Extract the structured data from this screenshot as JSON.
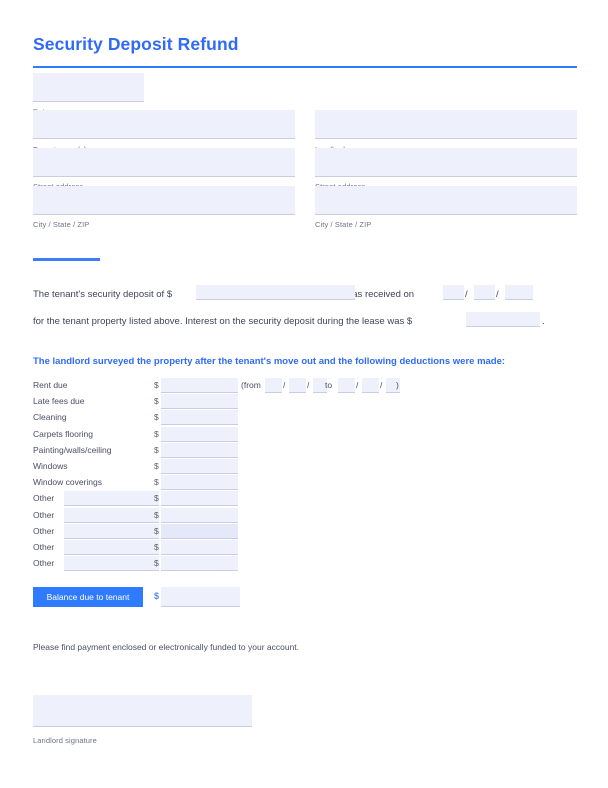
{
  "document": {
    "title": "Security Deposit Refund",
    "accent_color": "#2f7bff",
    "title_color": "#2f6bf6",
    "field_fill": "#eef0fb",
    "text_color": "#4a4f63"
  },
  "header": {
    "date_field": {
      "value": "",
      "placeholder": ""
    },
    "date_label": "Date",
    "left_column": [
      {
        "label": "Tenant name(s)",
        "value": "",
        "placeholder": ""
      },
      {
        "label": "Street address",
        "value": "",
        "placeholder": ""
      },
      {
        "label": "City / State / ZIP",
        "value": "",
        "placeholder": ""
      }
    ],
    "right_column": [
      {
        "label": "Landlord name",
        "value": "",
        "placeholder": ""
      },
      {
        "label": "Street address",
        "value": "",
        "placeholder": ""
      },
      {
        "label": "City / State / ZIP",
        "value": "",
        "placeholder": ""
      }
    ]
  },
  "body": {
    "line1_part1": "The tenant's security deposit of $",
    "line1_part2": "was received on",
    "line2": "for the tenant property listed above. Interest on the security deposit during the lease was $",
    "line2_period": ".",
    "slash": "/",
    "deposit_amount": {
      "value": "",
      "placeholder": ""
    },
    "received_month": {
      "value": "",
      "placeholder": ""
    },
    "received_day": {
      "value": "",
      "placeholder": ""
    },
    "received_year": {
      "value": "",
      "placeholder": ""
    },
    "interest_amount": {
      "value": "",
      "placeholder": ""
    }
  },
  "deductions": {
    "heading": "The landlord surveyed the property after the tenant's move out and the following deductions were made:",
    "dollar_sign": "$",
    "rent_range": {
      "from_label": "(from",
      "to_label": "to",
      "close_label": ")",
      "slash": "/",
      "from_month": {
        "value": ""
      },
      "from_day": {
        "value": ""
      },
      "from_year": {
        "value": ""
      },
      "to_month": {
        "value": ""
      },
      "to_day": {
        "value": ""
      },
      "to_year": {
        "value": ""
      }
    },
    "rows": [
      {
        "label": "Rent due",
        "editable_label": false,
        "label_value": "",
        "amount": "",
        "highlight": false,
        "has_range": true
      },
      {
        "label": "Late fees due",
        "editable_label": false,
        "label_value": "",
        "amount": "",
        "highlight": false,
        "has_range": false
      },
      {
        "label": "Cleaning",
        "editable_label": false,
        "label_value": "",
        "amount": "",
        "highlight": false,
        "has_range": false
      },
      {
        "label": "Carpets flooring",
        "editable_label": false,
        "label_value": "",
        "amount": "",
        "highlight": false,
        "has_range": false
      },
      {
        "label": "Painting/walls/ceiling",
        "editable_label": false,
        "label_value": "",
        "amount": "",
        "highlight": false,
        "has_range": false
      },
      {
        "label": "Windows",
        "editable_label": false,
        "label_value": "",
        "amount": "",
        "highlight": false,
        "has_range": false
      },
      {
        "label": "Window coverings",
        "editable_label": false,
        "label_value": "",
        "amount": "",
        "highlight": false,
        "has_range": false
      },
      {
        "label": "Other",
        "editable_label": true,
        "label_value": "",
        "amount": "",
        "highlight": false,
        "has_range": false
      },
      {
        "label": "Other",
        "editable_label": true,
        "label_value": "",
        "amount": "",
        "highlight": false,
        "has_range": false
      },
      {
        "label": "Other",
        "editable_label": true,
        "label_value": "",
        "amount": "",
        "highlight": true,
        "has_range": false
      },
      {
        "label": "Other",
        "editable_label": true,
        "label_value": "",
        "amount": "",
        "highlight": false,
        "has_range": false
      },
      {
        "label": "Other",
        "editable_label": true,
        "label_value": "",
        "amount": "",
        "highlight": false,
        "has_range": false
      }
    ]
  },
  "balance": {
    "label": "Balance due to tenant",
    "dollar_sign": "$",
    "amount": {
      "value": "",
      "placeholder": ""
    }
  },
  "footer": {
    "closing_text": "Please find payment enclosed or electronically funded to your account.",
    "signature": {
      "value": "",
      "placeholder": ""
    },
    "signature_label": "Landlord signature"
  }
}
